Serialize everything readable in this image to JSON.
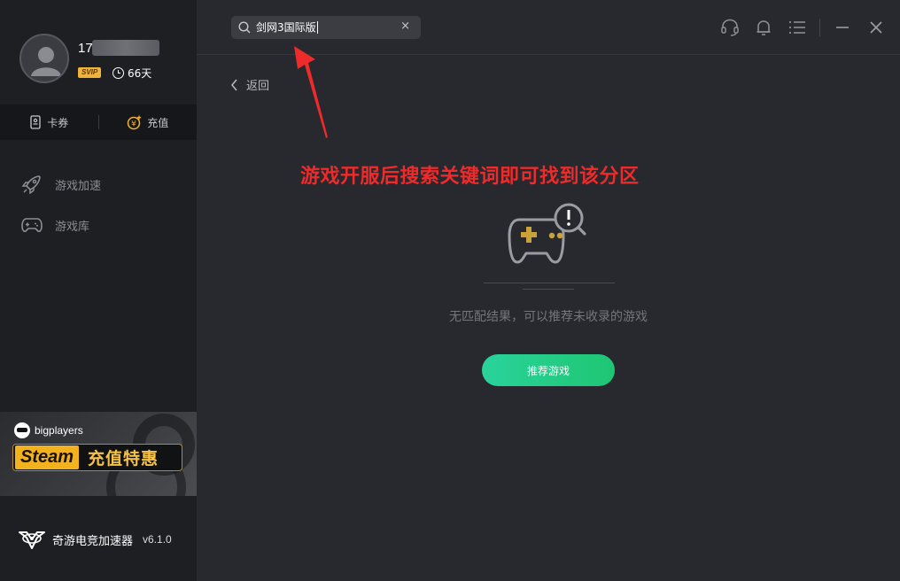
{
  "user": {
    "name_prefix": "17",
    "vip_badge": "SVIP",
    "days": "66天",
    "avatar_icon": "user-avatar-icon"
  },
  "wallet": {
    "coupon_label": "卡券",
    "recharge_label": "充值"
  },
  "sidebar": {
    "items": [
      {
        "label": "游戏加速",
        "icon": "rocket-icon"
      },
      {
        "label": "游戏库",
        "icon": "gamepad-icon"
      }
    ]
  },
  "banner": {
    "brand": "bigplayers",
    "steam_word": "Steam",
    "promo": "充值特惠"
  },
  "app": {
    "name": "奇游电竞加速器",
    "version": "v6.1.0"
  },
  "search": {
    "value": "剑网3国际版",
    "clear": "×"
  },
  "main": {
    "back_label": "返回",
    "annotation": "游戏开服后搜索关键词即可找到该分区",
    "empty_text": "无匹配结果，可以推荐未收录的游戏",
    "recommend_label": "推荐游戏"
  },
  "colors": {
    "accent_green": "#1ec673",
    "annotation_red": "#ee2a2a",
    "vip_gold": "#f0b23a"
  }
}
